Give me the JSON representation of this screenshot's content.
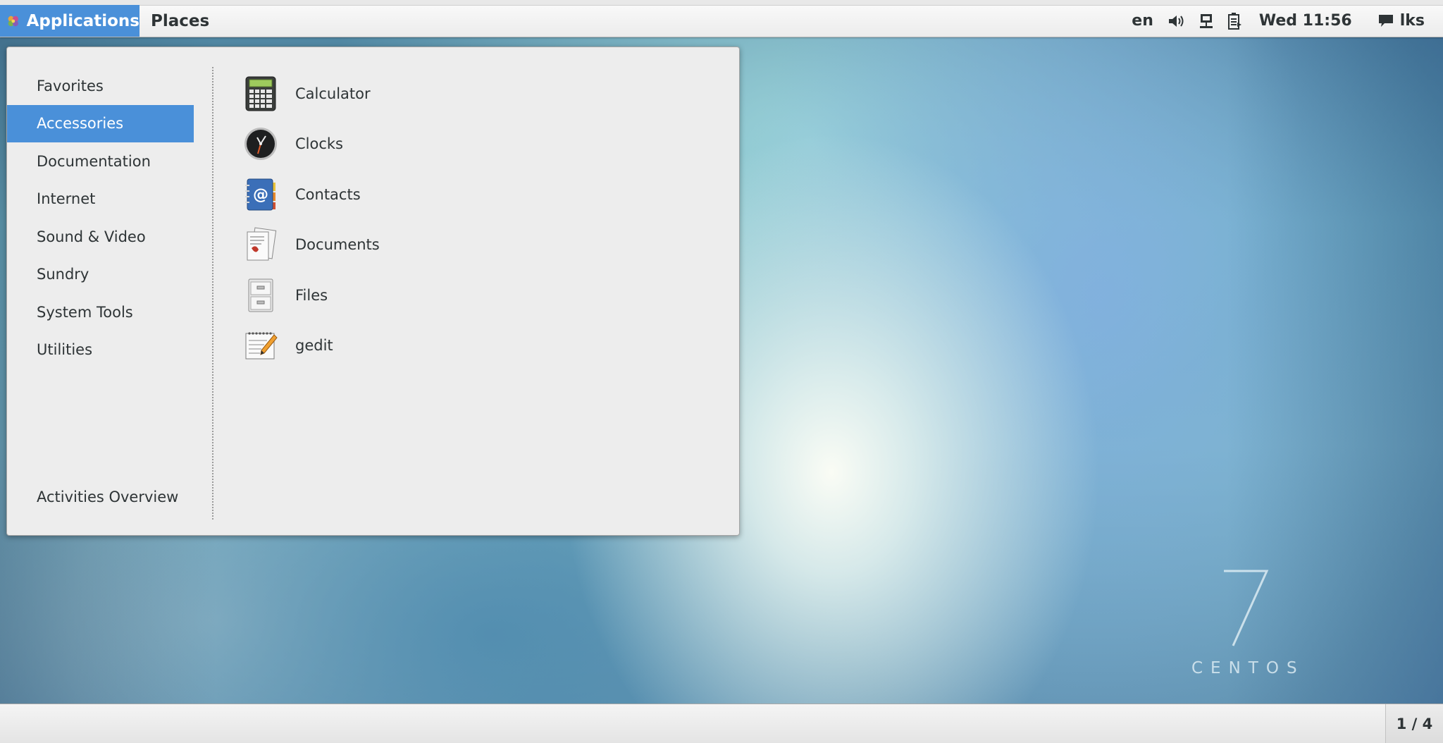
{
  "top_panel": {
    "applications_label": "Applications",
    "places_label": "Places",
    "language": "en",
    "clock": "Wed 11:56",
    "user": "lks"
  },
  "menu": {
    "categories": [
      {
        "label": "Favorites",
        "selected": false
      },
      {
        "label": "Accessories",
        "selected": true
      },
      {
        "label": "Documentation",
        "selected": false
      },
      {
        "label": "Internet",
        "selected": false
      },
      {
        "label": "Sound & Video",
        "selected": false
      },
      {
        "label": "Sundry",
        "selected": false
      },
      {
        "label": "System Tools",
        "selected": false
      },
      {
        "label": "Utilities",
        "selected": false
      }
    ],
    "activities_label": "Activities Overview",
    "apps": [
      {
        "label": "Calculator",
        "icon": "calculator-icon"
      },
      {
        "label": "Clocks",
        "icon": "clock-icon"
      },
      {
        "label": "Contacts",
        "icon": "contacts-icon"
      },
      {
        "label": "Documents",
        "icon": "documents-icon"
      },
      {
        "label": "Files",
        "icon": "file-cabinet-icon"
      },
      {
        "label": "gedit",
        "icon": "text-editor-icon"
      }
    ]
  },
  "desktop": {
    "watermark_number": "7",
    "watermark_word": "CENTOS"
  },
  "bottom_panel": {
    "workspace": "1 / 4"
  },
  "colors": {
    "accent": "#4a90d9",
    "menu_bg": "#ededed",
    "text": "#2e3436"
  }
}
